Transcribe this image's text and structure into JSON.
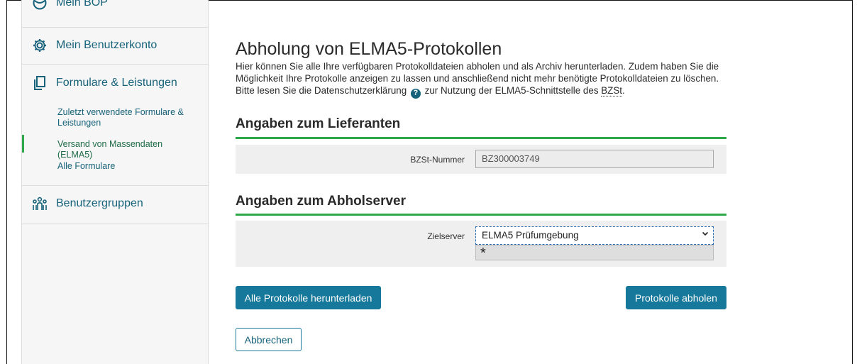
{
  "sidebar": {
    "items": [
      {
        "label": "Mein BOP",
        "icon": "globe-icon"
      },
      {
        "label": "Mein Benutzerkonto",
        "icon": "gear-icon"
      },
      {
        "label": "Formulare & Leistungen",
        "icon": "documents-icon",
        "subitems": [
          {
            "label": "Zuletzt verwendete Formulare & Leistungen"
          },
          {
            "label": "Versand von Massendaten (ELMA5)",
            "active": true
          },
          {
            "label": "Alle Formulare"
          }
        ]
      },
      {
        "label": "Benutzergruppen",
        "icon": "users-group-icon"
      }
    ]
  },
  "main": {
    "title": "Abholung von ELMA5-Protokollen",
    "intro_part1": "Hier können Sie alle Ihre verfügbaren Protokolldateien abholen und als Archiv herunterladen. Zudem haben Sie die Möglichkeit Ihre Protokolle anzeigen zu lassen und anschließend nicht mehr benötigte Protokolldateien zu löschen. Bitte lesen Sie die Datenschutzerklärung",
    "intro_part2": "zur Nutzung der ELMA5-Schnittstelle des",
    "intro_abbr": "BZSt",
    "intro_end": ".",
    "help_glyph": "?",
    "supplier_section": {
      "title": "Angaben zum Lieferanten",
      "field_label": "BZSt-Nummer",
      "field_value": "BZ300003749"
    },
    "server_section": {
      "title": "Angaben zum Abholserver",
      "field_label": "Zielserver",
      "selected_value": "ELMA5 Prüfumgebung",
      "required_marker": "*"
    },
    "buttons": {
      "download_all": "Alle Protokolle herunterladen",
      "fetch": "Protokolle abholen",
      "cancel": "Abbrechen"
    }
  },
  "colors": {
    "accent": "#16789a",
    "link": "#16627a",
    "section_line": "#2ea84b"
  }
}
